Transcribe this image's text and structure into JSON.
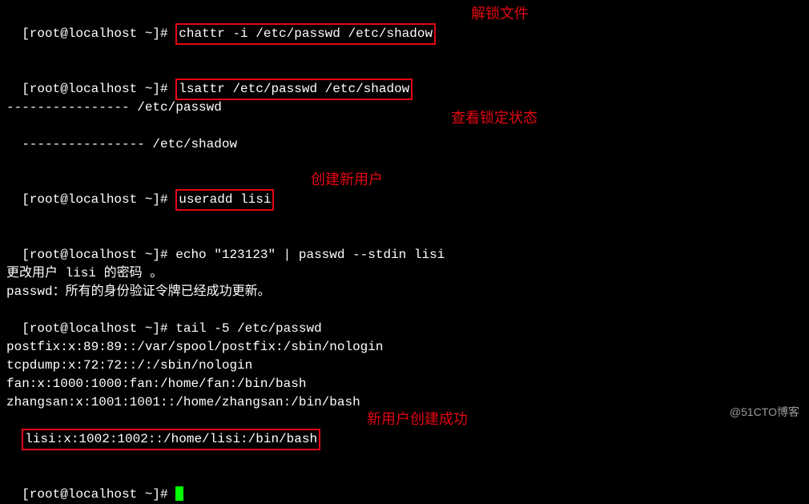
{
  "prompt": "[root@localhost ~]# ",
  "lines": {
    "cmd1": "chattr -i /etc/passwd /etc/shadow",
    "cmd2": "lsattr /etc/passwd /etc/shadow",
    "out2a": "---------------- /etc/passwd",
    "out2b": "---------------- /etc/shadow",
    "cmd3": "useradd lisi",
    "cmd4": "echo \"123123\" | passwd --stdin lisi",
    "out4a": "更改用户 lisi 的密码 。",
    "out4b": "passwd：所有的身份验证令牌已经成功更新。",
    "cmd5": "tail -5 /etc/passwd",
    "out5a": "postfix:x:89:89::/var/spool/postfix:/sbin/nologin",
    "out5b": "tcpdump:x:72:72::/:/sbin/nologin",
    "out5c": "fan:x:1000:1000:fan:/home/fan:/bin/bash",
    "out5d": "zhangsan:x:1001:1001::/home/zhangsan:/bin/bash",
    "out5e": "lisi:x:1002:1002::/home/lisi:/bin/bash"
  },
  "annotations": {
    "a1": "解锁文件",
    "a2": "查看锁定状态",
    "a3": "创建新用户",
    "a4": "新用户创建成功"
  },
  "watermark": "@51CTO博客"
}
